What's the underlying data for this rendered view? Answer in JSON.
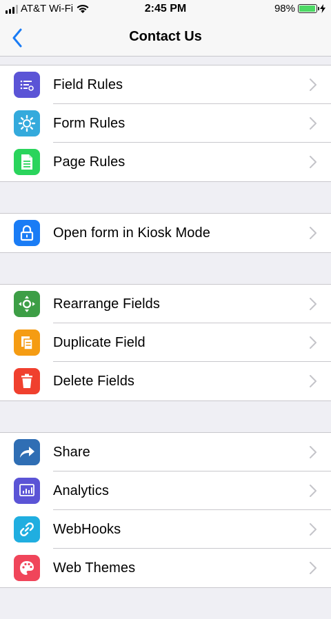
{
  "status": {
    "carrier": "AT&T Wi-Fi",
    "time": "2:45 PM",
    "battery": "98%",
    "battery_level": 0.98
  },
  "nav": {
    "back_icon": "chevron-left-icon",
    "title": "Contact Us"
  },
  "groups": [
    {
      "items": [
        {
          "label": "Field Rules",
          "icon": "field-rules-icon",
          "color": "#5b54d6"
        },
        {
          "label": "Form Rules",
          "icon": "gear-icon",
          "color": "#34aadc"
        },
        {
          "label": "Page Rules",
          "icon": "document-icon",
          "color": "#2ad45c"
        }
      ]
    },
    {
      "items": [
        {
          "label": "Open form in Kiosk Mode",
          "icon": "lock-icon",
          "color": "#1a7cf5"
        }
      ]
    },
    {
      "items": [
        {
          "label": "Rearrange Fields",
          "icon": "move-icon",
          "color": "#3d9e46"
        },
        {
          "label": "Duplicate Field",
          "icon": "duplicate-icon",
          "color": "#f59c13"
        },
        {
          "label": "Delete Fields",
          "icon": "trash-icon",
          "color": "#f0402e"
        }
      ]
    },
    {
      "items": [
        {
          "label": "Share",
          "icon": "share-icon",
          "color": "#2f6eb4"
        },
        {
          "label": "Analytics",
          "icon": "analytics-icon",
          "color": "#5b54d6"
        },
        {
          "label": "WebHooks",
          "icon": "link-icon",
          "color": "#20aee0"
        },
        {
          "label": "Web Themes",
          "icon": "palette-icon",
          "color": "#f0455a"
        }
      ]
    }
  ],
  "colors": {
    "accent": "#1a7cf5",
    "chevron": "#c4c4c9"
  }
}
